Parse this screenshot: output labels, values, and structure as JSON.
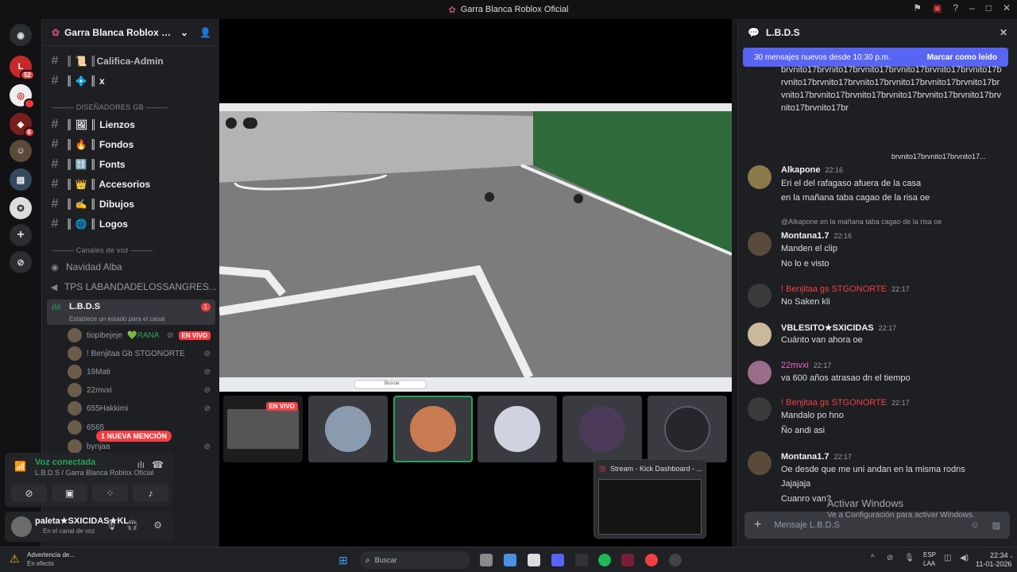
{
  "window": {
    "title": "Garra Blanca Roblox Oficial"
  },
  "servers": {
    "badges": [
      "52",
      "7",
      "6"
    ]
  },
  "guild": {
    "name": "Garra Blanca Roblox Ofi..."
  },
  "channels": {
    "top": [
      {
        "label": "║ 📜 ║Califica-Admin"
      },
      {
        "label": "║ 💠 ║ x"
      }
    ],
    "category1": "——— DISEÑADORES GB ———",
    "designers": [
      {
        "label": "║ 🖼 ║ Lienzos"
      },
      {
        "label": "║ 🔥 ║ Fondos"
      },
      {
        "label": "║ 🔠 ║ Fonts"
      },
      {
        "label": "║ 👑 ║ Accesorios"
      },
      {
        "label": "║ ✍ ║ Dibujos"
      },
      {
        "label": "║ 🌐 ║ Logos"
      }
    ],
    "category2": "——— Canales de voz ———",
    "voice": [
      {
        "label": "Navidad Alba"
      },
      {
        "label": "TPS LABANDADELOSSANGRES..."
      }
    ],
    "active_voice": {
      "label": "L.B.D.S",
      "status": "Establece un estado para el canal",
      "badge": "1"
    },
    "voice_users": [
      {
        "name": "tiopibejeje",
        "extra": "💚RANA",
        "live": "EN VIVO"
      },
      {
        "name": "! Benjitaa Gb STGONORTE"
      },
      {
        "name": "19Mati"
      },
      {
        "name": "22mvxi"
      },
      {
        "name": "655Hakkimi"
      },
      {
        "name": "6565"
      },
      {
        "name": "bynjaa"
      }
    ],
    "mention": "1 NUEVA MENCIÓN"
  },
  "voice_panel": {
    "status": "Voz conectada",
    "location": "L.B.D.S / Garra Blanca Roblox Oficial"
  },
  "user_panel": {
    "name": "paleta★SXICIDAS★KL...",
    "status": "En el canal de voz"
  },
  "stage": {
    "tiles": [
      {
        "label": "EN VIVO"
      }
    ],
    "preview_title": "Stream - Kick Dashboard - ..."
  },
  "chat": {
    "channel": "L.B.D.S",
    "new_bar": {
      "text": "30 mensajes nuevos desde 10:30 p.m.",
      "action": "Marcar como leído"
    },
    "spam": "brvnito17brvnito17brvnito17brvnito17brvnito17brvnito17brvnito17brvnito17brvnito17brvnito17brvnito17brvnito17brvnito17brvnito17brvnito17brvnito17brvnito17brvnito17brvnito17brvnito17br",
    "reply1": "brvnito17brvnito17brvnito17...",
    "messages": [
      {
        "author": "Alkapone",
        "time": "22:16",
        "lines": [
          "Eri el del rafagaso afuera de la casa",
          "en la mañana taba cagao de la risa oe"
        ]
      },
      {
        "reply": "@Alkapone en la mañana taba cagao de la risa oe",
        "author": "Montana1.7",
        "time": "22:16",
        "lines": [
          "Manden el clip",
          "No lo e visto"
        ]
      },
      {
        "author": "! Benjitaa gs STGONORTE",
        "time": "22:17",
        "lines": [
          "No Saken kli"
        ]
      },
      {
        "author": "VBLESITO★SXICIDAS",
        "time": "22:17",
        "lines": [
          "Cuánto van ahora oe"
        ]
      },
      {
        "author": "22mvxi",
        "time": "22:17",
        "lines": [
          "va 600 años atrasao dn el tiempo"
        ]
      },
      {
        "author": "! Benjitaa gs STGONORTE",
        "time": "22:17",
        "lines": [
          "Mandalo po hno",
          "Ño andi asi"
        ]
      },
      {
        "author": "Montana1.7",
        "time": "22:17",
        "lines": [
          "Oe desde que me uni andan en la misma rodns",
          "Jajajaja",
          "Cuanro van?"
        ]
      }
    ],
    "composer_placeholder": "Mensaje L.B.D.S"
  },
  "watermark": {
    "title": "Activar Windows",
    "sub": "Ve a Configuración para activar Windows."
  },
  "taskbar": {
    "warning_title": "Advertencia de...",
    "warning_sub": "En efecto",
    "search": "Buscar",
    "lang1": "ESP",
    "lang2": "LAA",
    "time": "22:34",
    "date": "11-01-2026"
  },
  "game_taskbar": {
    "search": "Buscar"
  }
}
